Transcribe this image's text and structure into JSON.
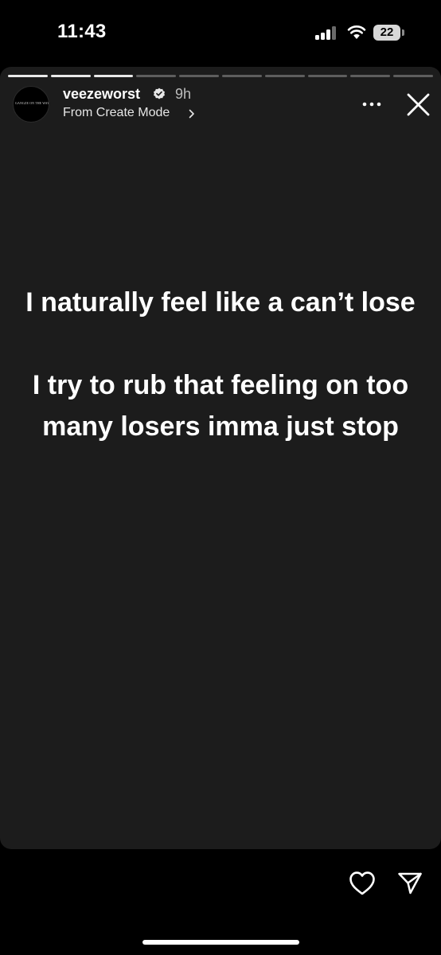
{
  "status_bar": {
    "time": "11:43",
    "battery": "22",
    "icons": [
      "signal-icon",
      "wifi-icon",
      "battery-icon"
    ]
  },
  "story": {
    "progress": {
      "segments": 10,
      "completed": 3
    },
    "avatar_text": "GANGZE ON THE WAY!",
    "username": "veezeworst",
    "verified": true,
    "time_ago": "9h",
    "subtitle": "From Create Mode",
    "text": {
      "paragraph1": "I naturally feel like a can’t lose",
      "paragraph2": "I try to rub that feeling on too many losers imma just stop"
    },
    "icons": [
      "verified-badge-icon",
      "chevron-right-icon",
      "more-options-icon",
      "close-icon"
    ]
  },
  "actions": {
    "icons": [
      "heart-icon",
      "send-icon"
    ]
  },
  "colors": {
    "story_background": "#1c1c1c",
    "page_background": "#000000",
    "text": "#ffffff",
    "secondary_text": "#bdbdbd"
  }
}
